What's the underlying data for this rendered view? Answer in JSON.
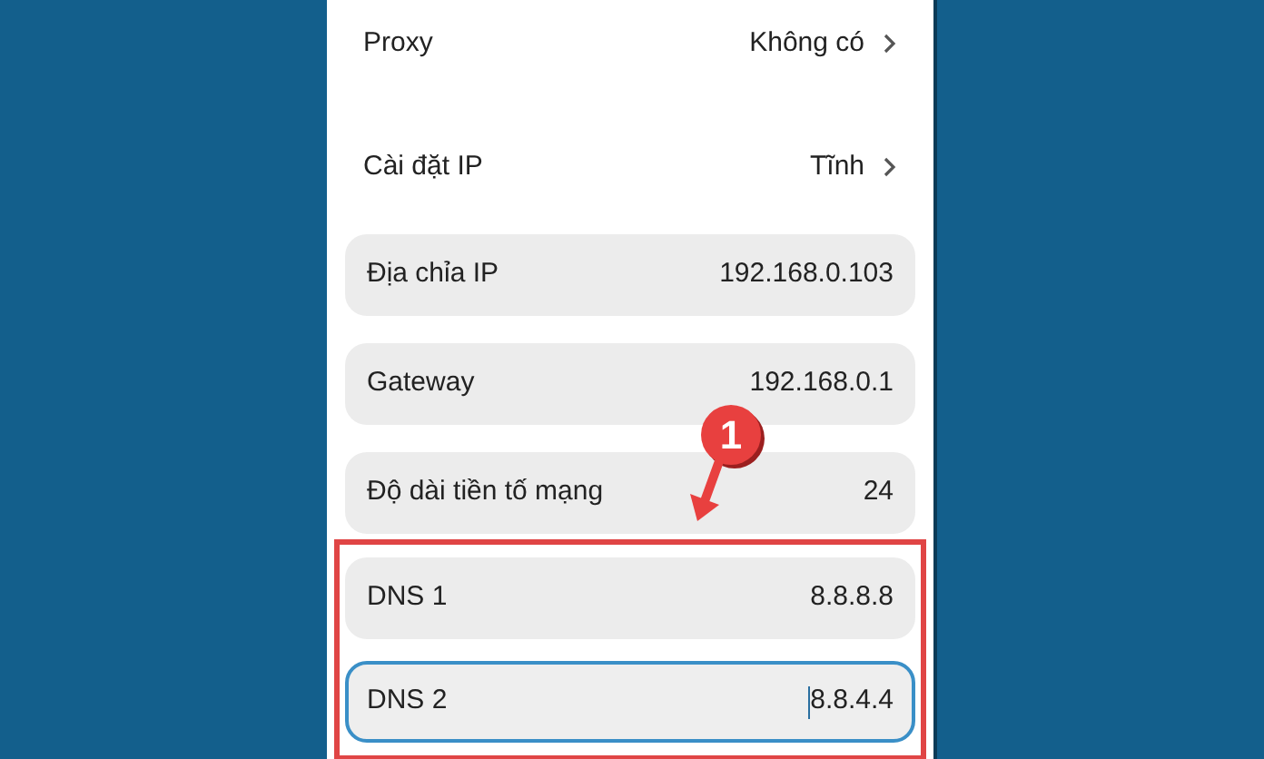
{
  "settings": [
    {
      "kind": "link",
      "label": "Proxy",
      "value": "Không có"
    },
    {
      "kind": "link",
      "label": "Cài đặt IP",
      "value": "Tĩnh"
    },
    {
      "kind": "field",
      "label": "Địa chỉa IP",
      "value": "192.168.0.103",
      "focused": false
    },
    {
      "kind": "field",
      "label": "Gateway",
      "value": "192.168.0.1",
      "focused": false
    },
    {
      "kind": "field",
      "label": "Độ dài tiền tố mạng",
      "value": "24",
      "focused": false
    }
  ],
  "highlighted_settings": [
    {
      "kind": "field",
      "label": "DNS 1",
      "value": "8.8.8.8",
      "focused": false
    },
    {
      "kind": "field",
      "label": "DNS 2",
      "value": "8.8.4.4",
      "focused": true
    }
  ],
  "annotation": {
    "badge": "1"
  }
}
